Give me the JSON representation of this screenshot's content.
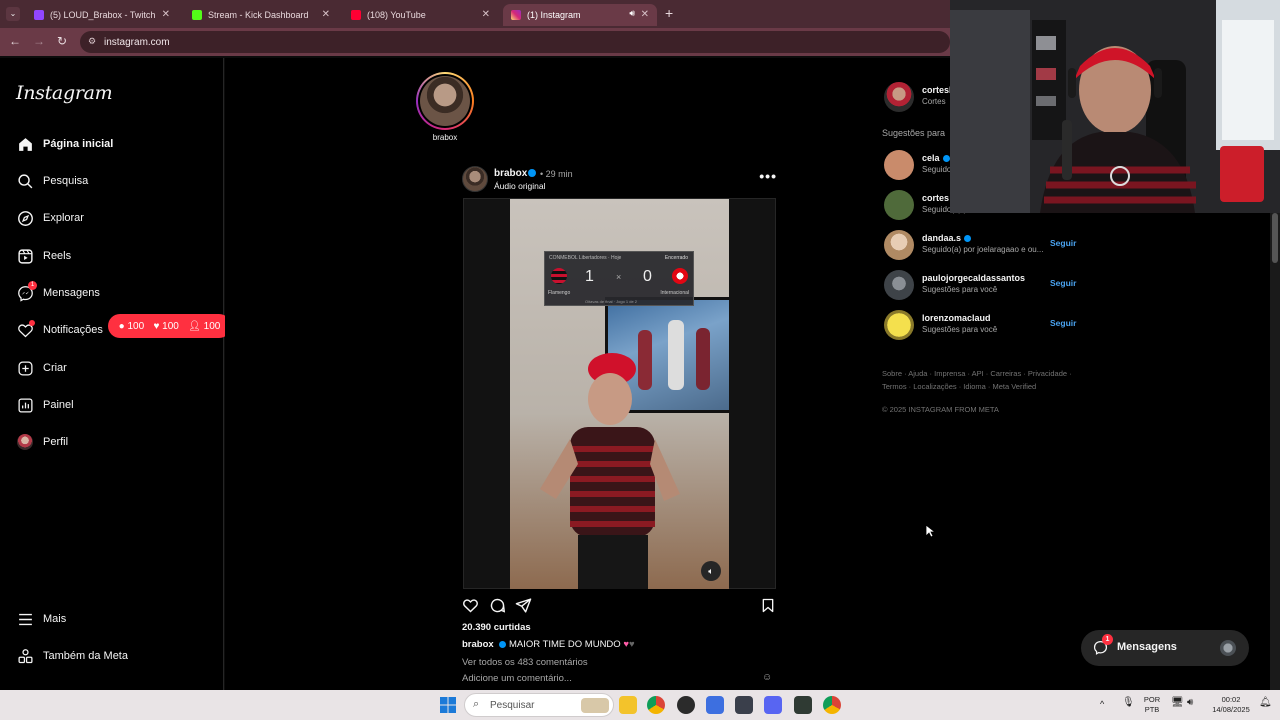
{
  "browser": {
    "tabs": [
      {
        "title": "(5) LOUD_Brabox - Twitch",
        "color": "#9146ff"
      },
      {
        "title": "Stream - Kick Dashboard",
        "color": "#53fc18"
      },
      {
        "title": "(108) YouTube",
        "color": "#ff0033"
      },
      {
        "title": "(1) Instagram",
        "color": "#e1306c"
      }
    ],
    "address": "instagram.com",
    "new_tab": "+"
  },
  "sidebar": {
    "logo": "Instagram",
    "items": [
      {
        "label": "Página inicial",
        "icon": "home-icon"
      },
      {
        "label": "Pesquisa",
        "icon": "search-icon"
      },
      {
        "label": "Explorar",
        "icon": "compass-icon"
      },
      {
        "label": "Reels",
        "icon": "reels-icon"
      },
      {
        "label": "Mensagens",
        "icon": "messenger-icon",
        "badge": "1"
      },
      {
        "label": "Notificações",
        "icon": "heart-icon"
      },
      {
        "label": "Criar",
        "icon": "plus-square-icon"
      },
      {
        "label": "Painel",
        "icon": "dashboard-icon"
      },
      {
        "label": "Perfil",
        "icon": "profile-avatar"
      }
    ],
    "more": "Mais",
    "meta": "Também da Meta",
    "notif_pill": {
      "comments": "100",
      "likes": "100",
      "follows": "100"
    }
  },
  "story": {
    "name": "brabox"
  },
  "post": {
    "username": "brabox",
    "time": "29 min",
    "time_sep": "•",
    "audio": "Áudio original",
    "more": "•••",
    "scoreboard": {
      "competition": "CONMEBOL Libertadores · Hoje",
      "status": "Encerrado",
      "home_score": "1",
      "away_score": "0",
      "sep": "×",
      "home_team": "Flamengo",
      "away_team": "Internacional",
      "footer": "Oitavas de final · Jogo 1 de 2"
    },
    "likes": "20.390 curtidas",
    "caption_user": "brabox",
    "caption_text": " MAIOR TIME DO MUNDO",
    "view_comments": "Ver todos os 483 comentários",
    "add_comment": "Adicione um comentário..."
  },
  "right": {
    "account_user": "cortesb",
    "account_sub": "Cortes",
    "suggestions_title": "Sugestões para",
    "suggestions": [
      {
        "name": "cela",
        "verified": true,
        "sub": "Seguido(a)",
        "follow": "",
        "color": "#c98b6b"
      },
      {
        "name": "cortes",
        "verified": false,
        "sub": "Seguido(a) por eduardoamarant...",
        "follow": "",
        "color": "#4f6a3a"
      },
      {
        "name": "dandaa.s",
        "verified": true,
        "sub": "Seguido(a) por joelaragaao e ou...",
        "follow": "Seguir",
        "color": "#d8c3a5"
      },
      {
        "name": "paulojorgecaldassantos",
        "verified": false,
        "sub": "Sugestões para você",
        "follow": "Seguir",
        "color": "#5d6268"
      },
      {
        "name": "lorenzomaclaud",
        "verified": false,
        "sub": "Sugestões para você",
        "follow": "Seguir",
        "color": "#e6d64a"
      }
    ],
    "footer_links": "Sobre · Ajuda · Imprensa · API · Carreiras · Privacidade · Termos · Localizações · Idioma · Meta Verified",
    "copyright": "© 2025 INSTAGRAM FROM META",
    "messages_label": "Mensagens",
    "messages_badge": "1"
  },
  "taskbar": {
    "search": "Pesquisar",
    "lang_top": "POR",
    "lang_bottom": "PTB",
    "time": "00:02",
    "date": "14/08/2025"
  }
}
